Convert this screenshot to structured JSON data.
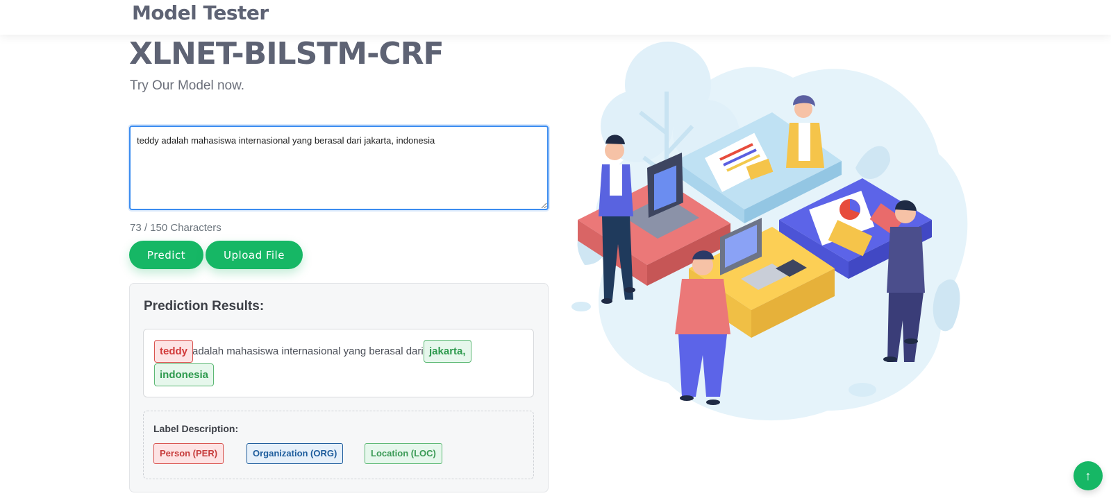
{
  "nav": {
    "brand": "Model Tester"
  },
  "hero": {
    "title": "XLNET-BILSTM-CRF",
    "subtitle": "Try Our Model now."
  },
  "input": {
    "value": "teddy adalah mahasiswa internasional yang berasal dari jakarta, indonesia",
    "char_count": "73 / 150 Characters"
  },
  "buttons": {
    "predict": "Predict",
    "upload": "Upload File"
  },
  "results": {
    "title": "Prediction Results:",
    "tokens": [
      {
        "text": "teddy",
        "label": "PER"
      },
      {
        "text": "adalah mahasiswa internasional yang berasal dari",
        "label": "O"
      },
      {
        "text": "jakarta,",
        "label": "LOC"
      },
      {
        "text": "indonesia",
        "label": "LOC"
      }
    ]
  },
  "labels": {
    "title": "Label Description:",
    "per": "Person (PER)",
    "org": "Organization (ORG)",
    "loc": "Location (LOC)"
  },
  "colors": {
    "accent": "#16b765",
    "per": "#d9534f",
    "org": "#1d5c9c",
    "loc": "#5cb874",
    "focus": "#3b8cf0"
  },
  "icons": {
    "scroll_top": "arrow-up-icon"
  }
}
